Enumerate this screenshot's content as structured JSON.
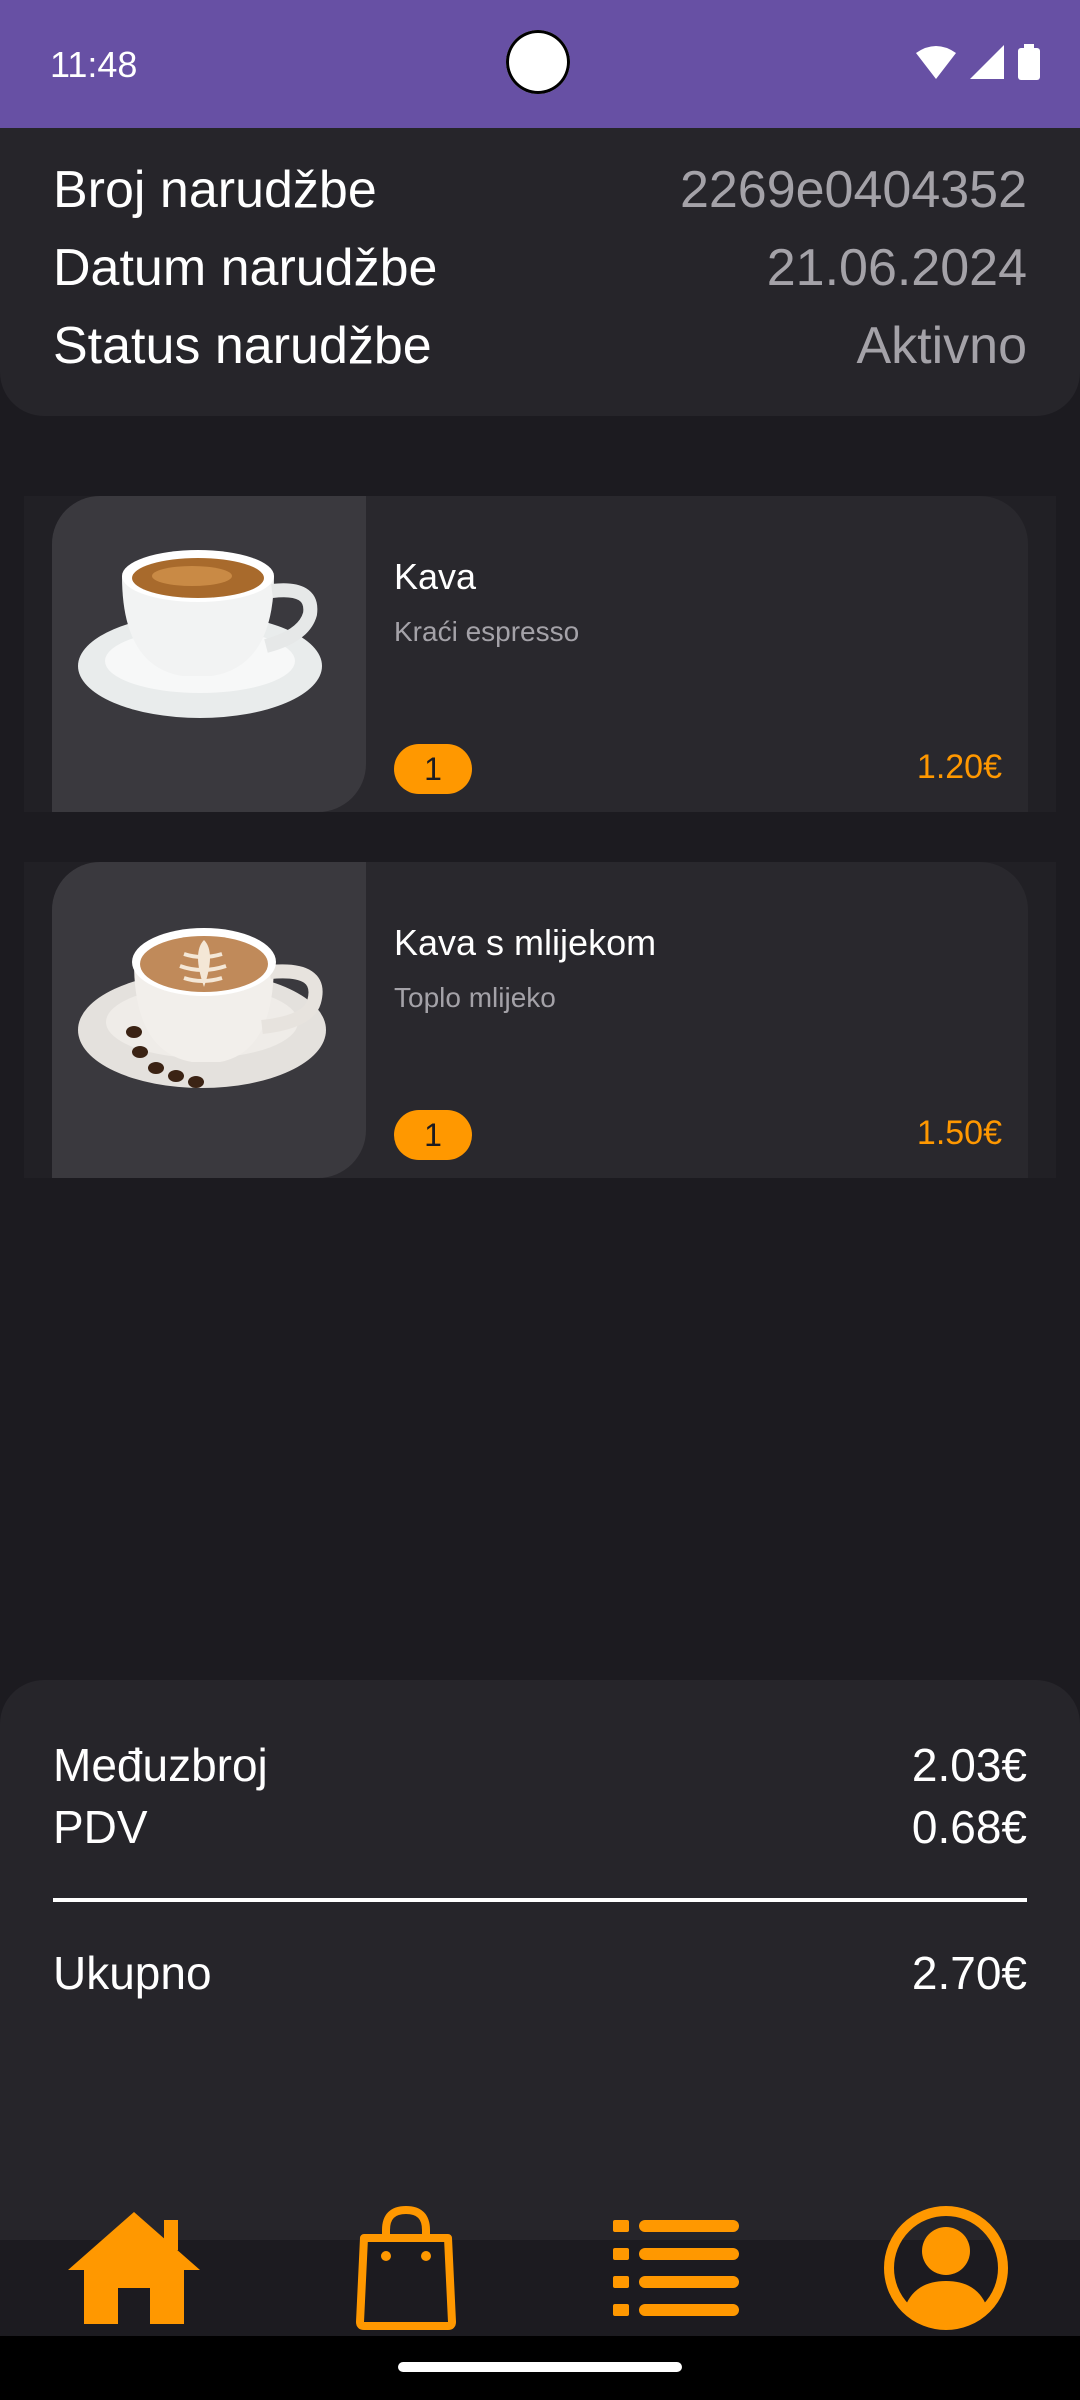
{
  "status_bar": {
    "time": "11:48",
    "icons": [
      "wifi-icon",
      "signal-icon",
      "battery-icon"
    ]
  },
  "order": {
    "number_label": "Broj narudžbe",
    "number_value": "2269e0404352",
    "date_label": "Datum narudžbe",
    "date_value": "21.06.2024",
    "status_label": "Status narudžbe",
    "status_value": "Aktivno"
  },
  "items": [
    {
      "title": "Kava",
      "subtitle": "Kraći espresso",
      "quantity": "1",
      "price": "1.20€",
      "image": "espresso-cup-image"
    },
    {
      "title": "Kava s mlijekom",
      "subtitle": "Toplo mlijeko",
      "quantity": "1",
      "price": "1.50€",
      "image": "latte-cup-image"
    }
  ],
  "summary": {
    "subtotal_label": "Međuzbroj",
    "subtotal_value": "2.03€",
    "vat_label": "PDV",
    "vat_value": "0.68€",
    "total_label": "Ukupno",
    "total_value": "2.70€"
  },
  "nav": {
    "items": [
      "home-icon",
      "shopping-bag-icon",
      "list-icon",
      "profile-icon"
    ],
    "accent": "#ff9800"
  },
  "colors": {
    "status_bar": "#6750a4",
    "background": "#1c1b20",
    "card": "#29282d",
    "accent": "#ff9800"
  }
}
